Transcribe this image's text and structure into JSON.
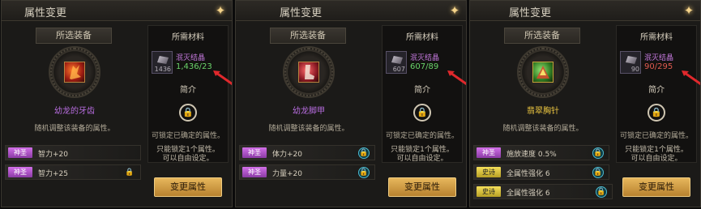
{
  "panels": [
    {
      "title": "属性变更",
      "selected_label": "所选装备",
      "item_name": "幼龙的牙齿",
      "item_color": "#b86de0",
      "item_icon": "red-dragon-fang-icon",
      "item_desc": "随机调整该装备的属性。",
      "materials_label": "所需材料",
      "material_name": "泯灭结晶",
      "material_count": "1436",
      "material_qty": "1,436/23",
      "material_qty_color": "#6ad36a",
      "intro_label": "简介",
      "lock_desc": "可锁定已确定的属性。",
      "note": "只能锁定1个属性。\n可以自由设定。",
      "button_label": "变更属性",
      "attrs": [
        {
          "badge": "神圣",
          "badge_color": "#c55de0",
          "text": "智力+20",
          "lock": "none"
        },
        {
          "badge": "神圣",
          "badge_color": "#c55de0",
          "text": "智力+25",
          "lock": "plain"
        }
      ]
    },
    {
      "title": "属性变更",
      "selected_label": "所选装备",
      "item_name": "幼龙脚甲",
      "item_color": "#b86de0",
      "item_icon": "red-dragon-boots-icon",
      "item_desc": "随机调整该装备的属性。",
      "materials_label": "所需材料",
      "material_name": "泯灭结晶",
      "material_count": "607",
      "material_qty": "607/89",
      "material_qty_color": "#6ad36a",
      "intro_label": "简介",
      "lock_desc": "可锁定已确定的属性。",
      "note": "只能锁定1个属性。\n可以自由设定。",
      "button_label": "变更属性",
      "attrs": [
        {
          "badge": "神圣",
          "badge_color": "#c55de0",
          "text": "体力+20",
          "lock": "active"
        },
        {
          "badge": "神圣",
          "badge_color": "#c55de0",
          "text": "力量+20",
          "lock": "active"
        }
      ]
    },
    {
      "title": "属性变更",
      "selected_label": "所选装备",
      "item_name": "翡翠胸针",
      "item_color": "#e8c340",
      "item_icon": "emerald-brooch-icon",
      "item_desc": "随机调整该装备的属性。",
      "materials_label": "所需材料",
      "material_name": "泯灭结晶",
      "material_count": "90",
      "material_qty": "90/295",
      "material_qty_color": "#e05a4f",
      "intro_label": "简介",
      "lock_desc": "可锁定已确定的属性。",
      "note": "只能锁定1个属性。\n可以自由设定。",
      "button_label": "变更属性",
      "attrs": [
        {
          "badge": "神圣",
          "badge_color": "#c55de0",
          "text": "施放速度 0.5%",
          "lock": "active"
        },
        {
          "badge": "史诗",
          "badge_color": "#e6cf3d",
          "text": "全属性强化 6",
          "lock": "active"
        },
        {
          "badge": "史诗",
          "badge_color": "#e6cf3d",
          "text": "全属性强化 6",
          "lock": "active"
        }
      ]
    }
  ]
}
